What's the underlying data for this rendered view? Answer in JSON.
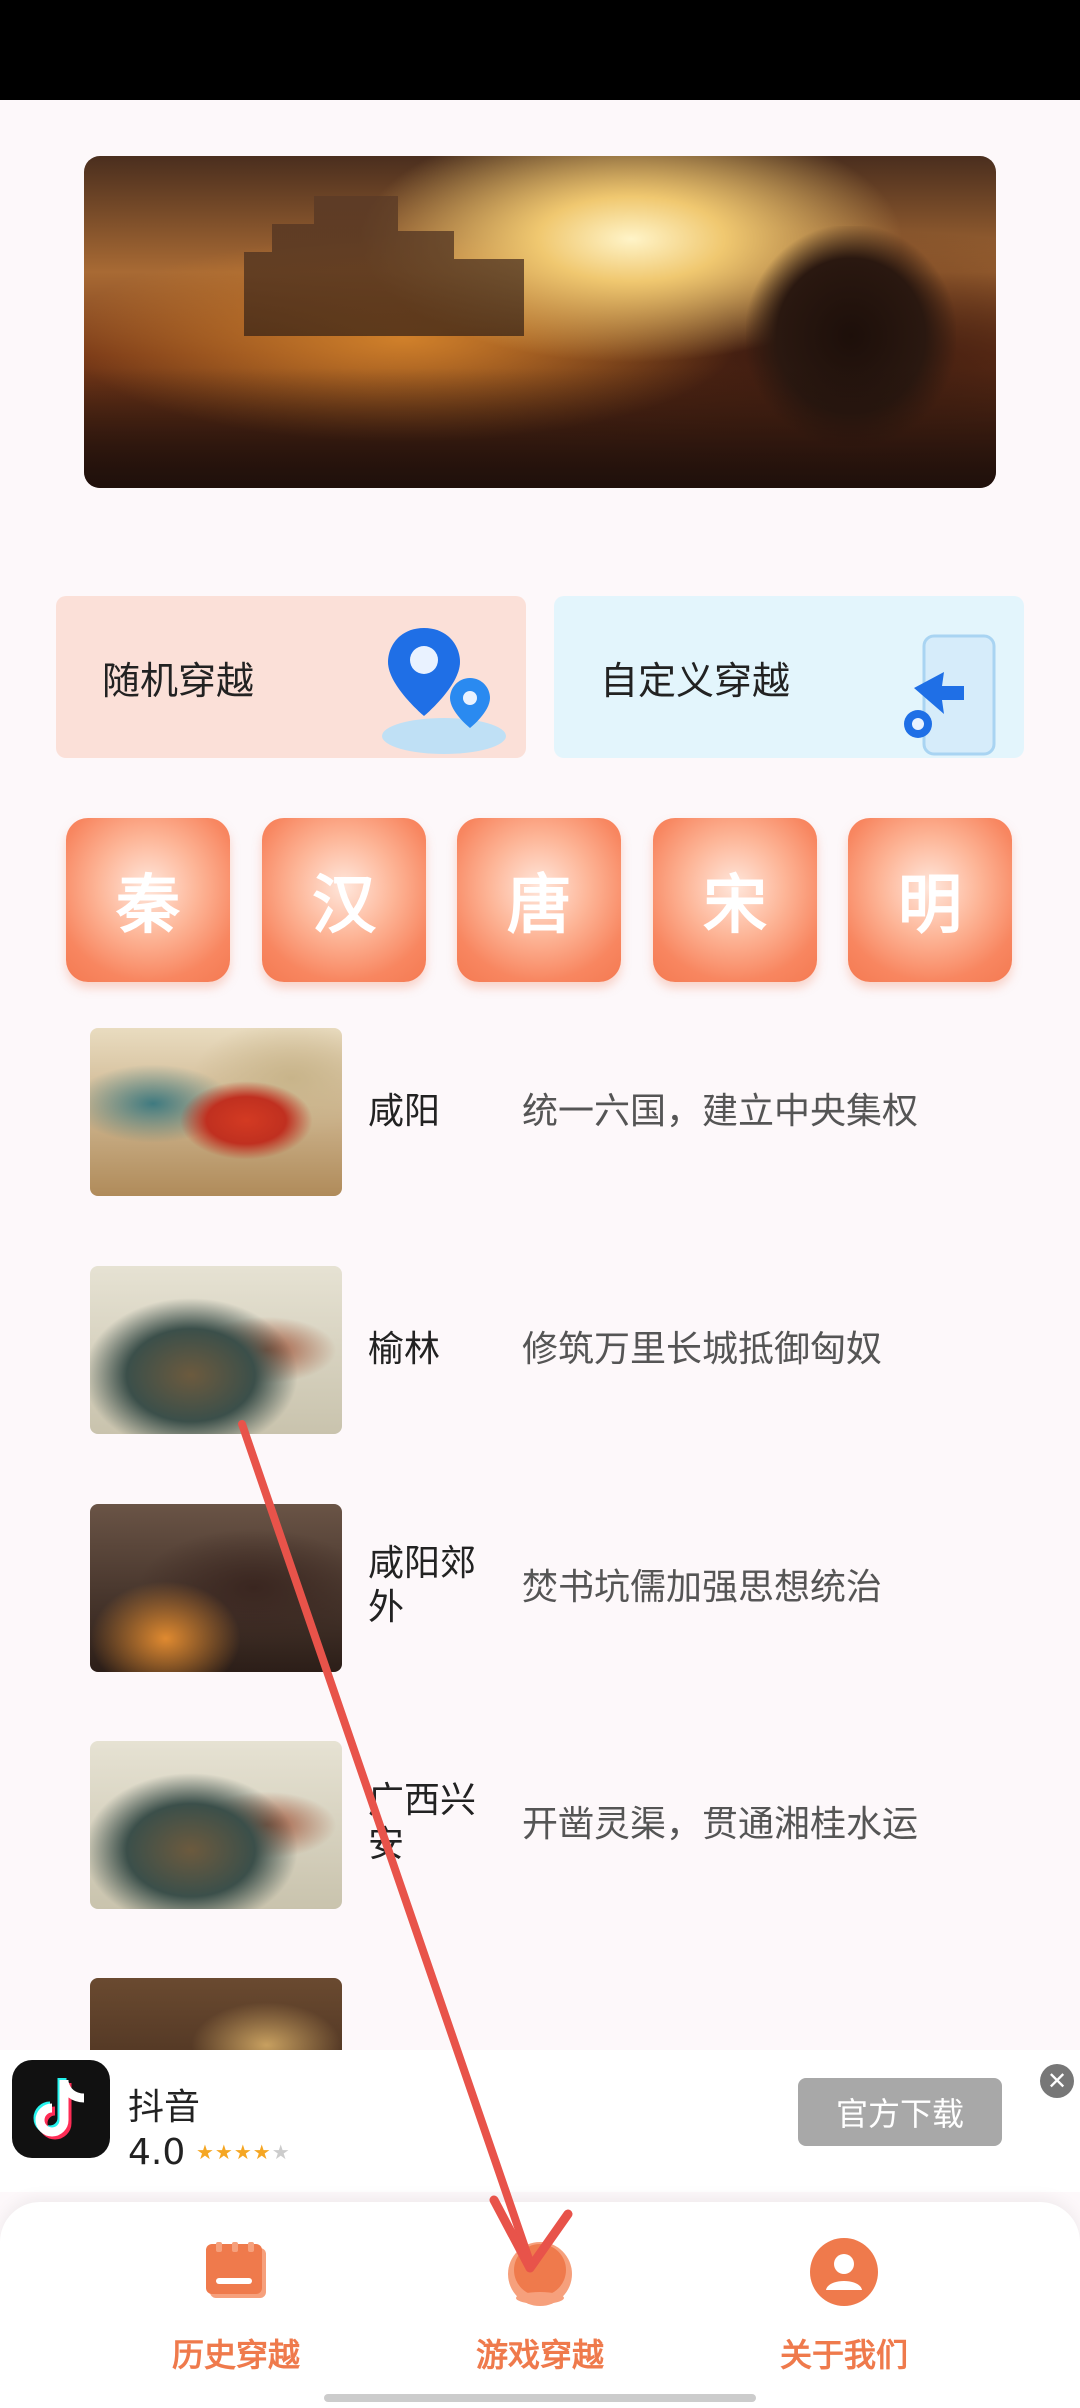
{
  "banner": {
    "alt": "battle scene banner"
  },
  "cards": {
    "random_label": "随机穿越",
    "custom_label": "自定义穿越"
  },
  "dynasties": [
    "秦",
    "汉",
    "唐",
    "宋",
    "明"
  ],
  "list": [
    {
      "place": "咸阳",
      "desc": "统一六国，建立中央集权"
    },
    {
      "place": "榆林",
      "desc": "修筑万里长城抵御匈奴"
    },
    {
      "place": "咸阳郊外",
      "desc": "焚书坑儒加强思想统治"
    },
    {
      "place": "广西兴安",
      "desc": "开凿灵渠，贯通湘桂水运"
    }
  ],
  "ad": {
    "app_name": "抖音",
    "rating": "4.0",
    "stars": "★★★★",
    "stars_empty": "★",
    "button": "官方下载",
    "close": "✕"
  },
  "tabs": [
    {
      "label": "历史穿越"
    },
    {
      "label": "游戏穿越"
    },
    {
      "label": "关于我们"
    }
  ],
  "colors": {
    "accent": "#ef7a4c",
    "arrow": "#e8534a"
  }
}
